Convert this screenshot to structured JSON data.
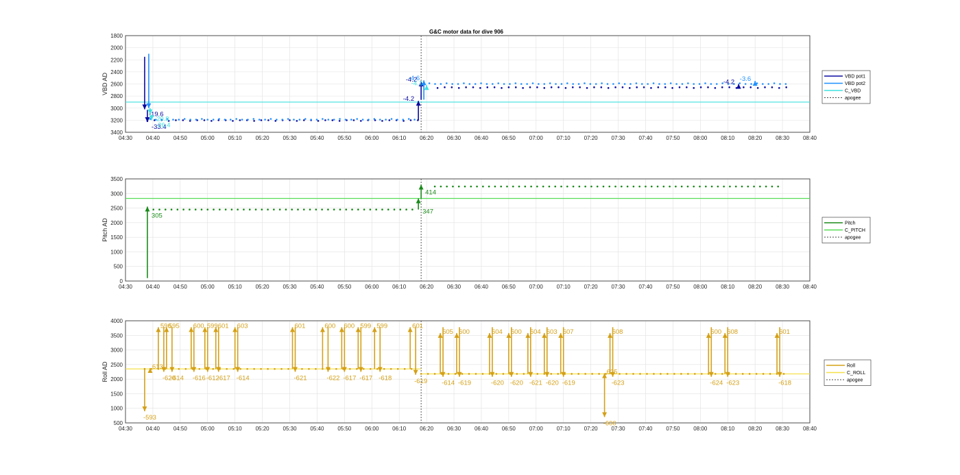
{
  "chart_data": [
    {
      "type": "scatter",
      "title": "G&C motor data for dive 906",
      "ylabel": "VBD AD",
      "ylim": [
        1800,
        3400
      ],
      "y_reversed": true,
      "yticks": [
        "1800",
        "2000",
        "2200",
        "2400",
        "2600",
        "2800",
        "3000",
        "3200",
        "3400"
      ],
      "xlim": [
        "04:30",
        "08:40"
      ],
      "xticks": [
        "04:30",
        "04:40",
        "04:50",
        "05:00",
        "05:10",
        "05:20",
        "05:30",
        "05:40",
        "05:50",
        "06:00",
        "06:10",
        "06:20",
        "06:30",
        "06:40",
        "06:50",
        "07:00",
        "07:10",
        "07:20",
        "07:30",
        "07:40",
        "07:50",
        "08:00",
        "08:10",
        "08:20",
        "08:30",
        "08:40"
      ],
      "grid": true,
      "legend_position": "right",
      "colors": {
        "pot1": "#0a0aa0",
        "pot2": "#1e90ff",
        "command": "#3fe0e0",
        "apogee": "#444444"
      },
      "legend": [
        "VBD pot1",
        "VBD pot2",
        "C_VBD",
        "apogee"
      ],
      "reference_lines": {
        "C_VBD": 2900,
        "apogee": "06:18"
      },
      "series": [
        {
          "name": "VBD pot1",
          "base": 3200,
          "segments": [
            {
              "from": "04:38",
              "to": "06:17",
              "level": 3200
            },
            {
              "from": "06:24",
              "to": "08:32",
              "level": 2655
            }
          ]
        },
        {
          "name": "VBD pot2",
          "base": 3190,
          "segments": [
            {
              "from": "04:39",
              "to": "06:16",
              "level": 3190
            },
            {
              "from": "06:21",
              "to": "08:32",
              "level": 2600
            }
          ]
        }
      ],
      "arrows": [
        {
          "series": "pot1",
          "t": "04:37",
          "from": 2150,
          "to": 3020,
          "label": "-19.6"
        },
        {
          "series": "pot1",
          "t": "04:38",
          "from": 3030,
          "to": 3230,
          "label": "-33.4"
        },
        {
          "series": "pot2",
          "t": "04:38.5",
          "from": 2100,
          "to": 3000,
          "label": ""
        },
        {
          "series": "command",
          "t": "04:39",
          "from": 3000,
          "to": 3100,
          "label": "-20.8"
        },
        {
          "series": "command",
          "t": "04:39.5",
          "from": 3110,
          "to": 3200,
          "label": "-26.4"
        },
        {
          "series": "pot1",
          "t": "06:17",
          "from": 3200,
          "to": 2880,
          "label": "-4.2"
        },
        {
          "series": "pot1",
          "t": "06:18",
          "from": 2860,
          "to": 2560,
          "label": "-4.2"
        },
        {
          "series": "pot2",
          "t": "06:19",
          "from": 2860,
          "to": 2540,
          "label": "-4.6"
        },
        {
          "series": "command",
          "t": "06:20",
          "from": 2650,
          "to": 2620,
          "label": "-4.1"
        },
        {
          "series": "pot1",
          "t": "08:14",
          "from": 2650,
          "to": 2600,
          "label": "-4.2"
        },
        {
          "series": "pot2",
          "t": "08:20",
          "from": 2610,
          "to": 2550,
          "label": "-3.6"
        }
      ]
    },
    {
      "type": "scatter",
      "ylabel": "Pitch AD",
      "ylim": [
        0,
        3500
      ],
      "yticks": [
        "0",
        "500",
        "1000",
        "1500",
        "2000",
        "2500",
        "3000",
        "3500"
      ],
      "xlim": [
        "04:30",
        "08:40"
      ],
      "xticks": [
        "04:30",
        "04:40",
        "04:50",
        "05:00",
        "05:10",
        "05:20",
        "05:30",
        "05:40",
        "05:50",
        "06:00",
        "06:10",
        "06:20",
        "06:30",
        "06:40",
        "06:50",
        "07:00",
        "07:10",
        "07:20",
        "07:30",
        "07:40",
        "07:50",
        "08:00",
        "08:10",
        "08:20",
        "08:30",
        "08:40"
      ],
      "grid": true,
      "legend_position": "right",
      "colors": {
        "pitch": "#1a8a1a",
        "command": "#55dd55",
        "apogee": "#444444"
      },
      "legend": [
        "Pitch",
        "C_PITCH",
        "apogee"
      ],
      "reference_lines": {
        "C_PITCH": 2830,
        "apogee": "06:18"
      },
      "series": [
        {
          "name": "Pitch",
          "segments": [
            {
              "from": "04:38",
              "to": "06:16",
              "level": 2450
            },
            {
              "from": "06:23",
              "to": "08:30",
              "level": 3240
            }
          ]
        }
      ],
      "arrows": [
        {
          "t": "04:38",
          "from": 100,
          "to": 2550,
          "label": "305"
        },
        {
          "t": "06:17",
          "from": 2450,
          "to": 2830,
          "label": "347"
        },
        {
          "t": "06:18",
          "from": 2830,
          "to": 3300,
          "label": "414"
        }
      ]
    },
    {
      "type": "scatter",
      "ylabel": "Roll AD",
      "ylim": [
        500,
        4000
      ],
      "yticks": [
        "500",
        "1000",
        "1500",
        "2000",
        "2500",
        "3000",
        "3500",
        "4000"
      ],
      "xlim": [
        "04:30",
        "08:40"
      ],
      "xticks": [
        "04:30",
        "04:40",
        "04:50",
        "05:00",
        "05:10",
        "05:20",
        "05:30",
        "05:40",
        "05:50",
        "06:00",
        "06:10",
        "06:20",
        "06:30",
        "06:40",
        "06:50",
        "07:00",
        "07:10",
        "07:20",
        "07:30",
        "07:40",
        "07:50",
        "08:00",
        "08:10",
        "08:20",
        "08:30",
        "08:40"
      ],
      "grid": true,
      "legend_position": "right",
      "colors": {
        "roll": "#d4a017",
        "command": "#f5e04a",
        "apogee": "#444444"
      },
      "legend": [
        "Roll",
        "C_ROLL",
        "apogee"
      ],
      "reference_lines": {
        "C_ROLL_before": 2350,
        "C_ROLL_after": 2180,
        "apogee": "06:18"
      },
      "series": [
        {
          "name": "Roll",
          "segments": [
            {
              "from": "04:37",
              "to": "06:16",
              "level": 2350
            },
            {
              "from": "06:18",
              "to": "08:31",
              "level": 2180
            }
          ]
        }
      ],
      "up_labels": [
        {
          "t": "04:39",
          "label": "613",
          "top": 2380
        },
        {
          "t": "04:42",
          "label": "596",
          "top": 3780
        },
        {
          "t": "04:45",
          "label": "595",
          "top": 3780
        },
        {
          "t": "04:54",
          "label": "600",
          "top": 3780
        },
        {
          "t": "04:59",
          "label": "599",
          "top": 3780
        },
        {
          "t": "05:03",
          "label": "601",
          "top": 3780
        },
        {
          "t": "05:10",
          "label": "603",
          "top": 3780
        },
        {
          "t": "05:31",
          "label": "601",
          "top": 3780
        },
        {
          "t": "05:42",
          "label": "600",
          "top": 3780
        },
        {
          "t": "05:49",
          "label": "600",
          "top": 3780
        },
        {
          "t": "05:55",
          "label": "599",
          "top": 3780
        },
        {
          "t": "06:01",
          "label": "599",
          "top": 3780
        },
        {
          "t": "06:14",
          "label": "601",
          "top": 3780
        },
        {
          "t": "06:25",
          "label": "605",
          "top": 3580
        },
        {
          "t": "06:31",
          "label": "600",
          "top": 3580
        },
        {
          "t": "06:43",
          "label": "604",
          "top": 3580
        },
        {
          "t": "06:50",
          "label": "600",
          "top": 3580
        },
        {
          "t": "06:57",
          "label": "604",
          "top": 3580
        },
        {
          "t": "07:03",
          "label": "603",
          "top": 3580
        },
        {
          "t": "07:09",
          "label": "607",
          "top": 3580
        },
        {
          "t": "07:25",
          "label": "625",
          "top": 2200
        },
        {
          "t": "07:27",
          "label": "608",
          "top": 3580
        },
        {
          "t": "08:03",
          "label": "600",
          "top": 3580
        },
        {
          "t": "08:09",
          "label": "608",
          "top": 3580
        },
        {
          "t": "08:28",
          "label": "601",
          "top": 3580
        }
      ],
      "down_labels": [
        {
          "t": "04:37",
          "label": "-593",
          "bottom": 900
        },
        {
          "t": "04:44",
          "label": "-620",
          "bottom": 2250
        },
        {
          "t": "04:47",
          "label": "-614",
          "bottom": 2250
        },
        {
          "t": "04:55",
          "label": "-616",
          "bottom": 2250
        },
        {
          "t": "05:00",
          "label": "-612",
          "bottom": 2250
        },
        {
          "t": "05:04",
          "label": "-617",
          "bottom": 2250
        },
        {
          "t": "05:11",
          "label": "-614",
          "bottom": 2250
        },
        {
          "t": "05:32",
          "label": "-621",
          "bottom": 2250
        },
        {
          "t": "05:44",
          "label": "-622",
          "bottom": 2250
        },
        {
          "t": "05:50",
          "label": "-617",
          "bottom": 2250
        },
        {
          "t": "05:56",
          "label": "-617",
          "bottom": 2250
        },
        {
          "t": "06:03",
          "label": "-618",
          "bottom": 2250
        },
        {
          "t": "06:16",
          "label": "-619",
          "bottom": 2150
        },
        {
          "t": "06:26",
          "label": "-614",
          "bottom": 2080
        },
        {
          "t": "06:32",
          "label": "-619",
          "bottom": 2080
        },
        {
          "t": "06:44",
          "label": "-620",
          "bottom": 2080
        },
        {
          "t": "06:51",
          "label": "-620",
          "bottom": 2080
        },
        {
          "t": "06:58",
          "label": "-621",
          "bottom": 2080
        },
        {
          "t": "07:04",
          "label": "-620",
          "bottom": 2080
        },
        {
          "t": "07:10",
          "label": "-619",
          "bottom": 2080
        },
        {
          "t": "07:25",
          "label": "-600",
          "bottom": 700
        },
        {
          "t": "07:28",
          "label": "-623",
          "bottom": 2080
        },
        {
          "t": "08:04",
          "label": "-624",
          "bottom": 2080
        },
        {
          "t": "08:10",
          "label": "-623",
          "bottom": 2080
        },
        {
          "t": "08:29",
          "label": "-618",
          "bottom": 2080
        }
      ]
    }
  ]
}
